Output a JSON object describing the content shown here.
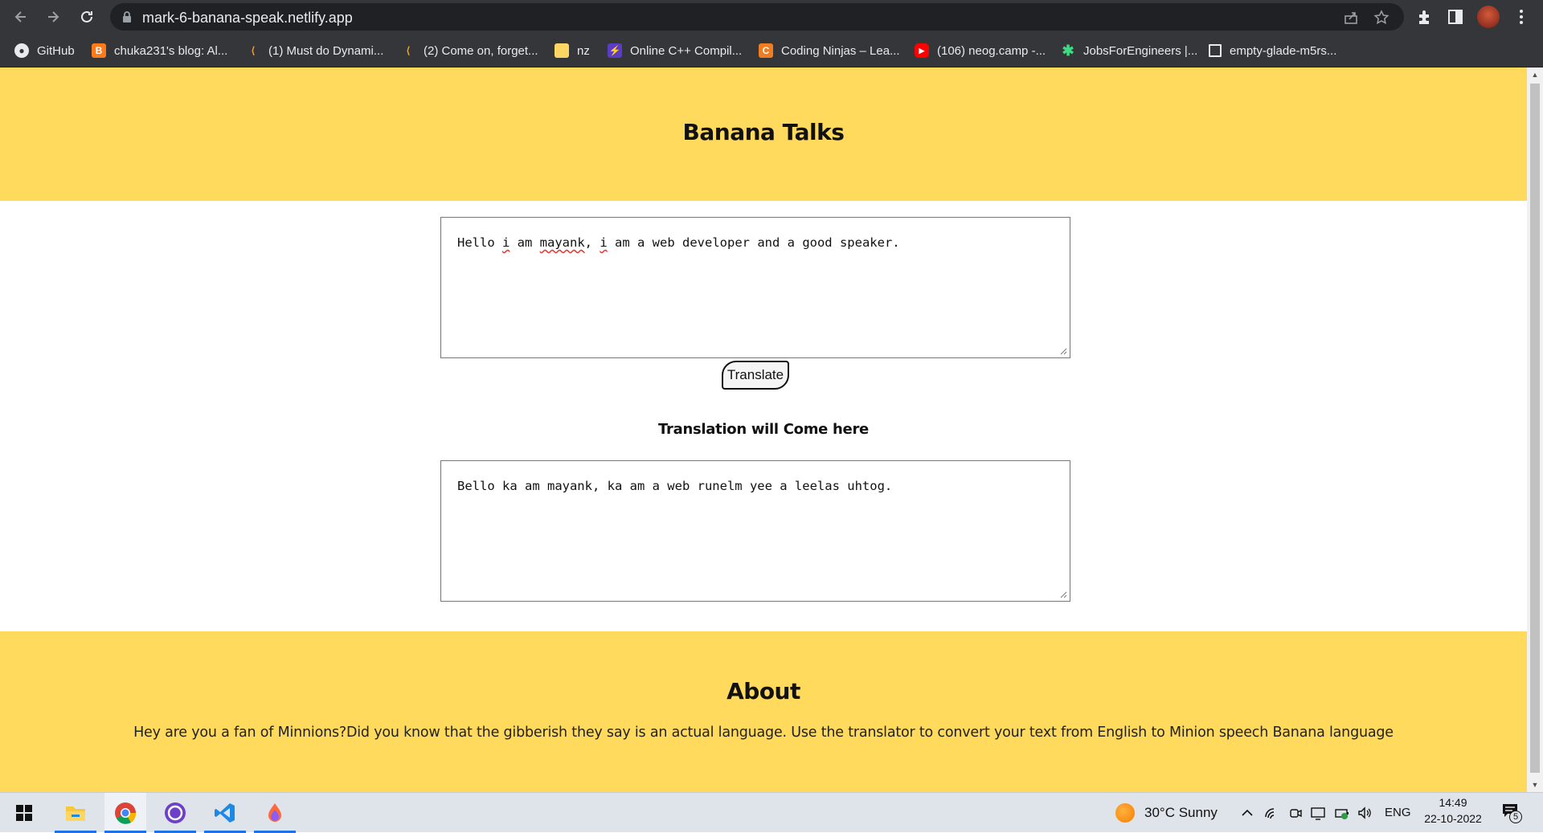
{
  "browser": {
    "url": "mark-6-banana-speak.netlify.app",
    "bookmarks": [
      {
        "label": "GitHub",
        "icon": "github-icon"
      },
      {
        "label": "chuka231's blog: Al...",
        "icon": "blogger-icon"
      },
      {
        "label": "(1) Must do Dynami...",
        "icon": "leetcode-icon"
      },
      {
        "label": "(2) Come on, forget...",
        "icon": "leetcode-icon"
      },
      {
        "label": "nz",
        "icon": "folder-icon"
      },
      {
        "label": "Online C++ Compil...",
        "icon": "bolt-icon"
      },
      {
        "label": "Coding Ninjas – Lea...",
        "icon": "codingninjas-icon"
      },
      {
        "label": "(106) neog.camp -...",
        "icon": "youtube-icon"
      },
      {
        "label": "JobsForEngineers |...",
        "icon": "star-burst-icon"
      },
      {
        "label": "empty-glade-m5rs...",
        "icon": "codesandbox-icon"
      }
    ]
  },
  "page": {
    "title": "Banana Talks",
    "input": {
      "value_parts": [
        {
          "text": "Hello ",
          "spell": false
        },
        {
          "text": "i",
          "spell": true
        },
        {
          "text": " am ",
          "spell": false
        },
        {
          "text": "mayank",
          "spell": true
        },
        {
          "text": ", ",
          "spell": false
        },
        {
          "text": "i",
          "spell": true
        },
        {
          "text": " am a web developer and a good speaker.",
          "spell": false
        }
      ]
    },
    "translate_label": "Translate",
    "output_label": "Translation will Come here",
    "output_value": "Bello ka am mayank, ka am a web runelm yee a leelas uhtog.",
    "about": {
      "heading": "About",
      "text": "Hey are you a fan of Minnions?Did you know that the gibberish they say is an actual language. Use the translator to convert your text from English to Minion speech Banana language"
    }
  },
  "taskbar": {
    "weather": "30°C  Sunny",
    "language": "ENG",
    "time": "14:49",
    "date": "22-10-2022",
    "notifications": "5"
  },
  "colors": {
    "brand_yellow": "#ffda5c",
    "chrome_dark": "#35363a",
    "omnibox": "#202124"
  }
}
